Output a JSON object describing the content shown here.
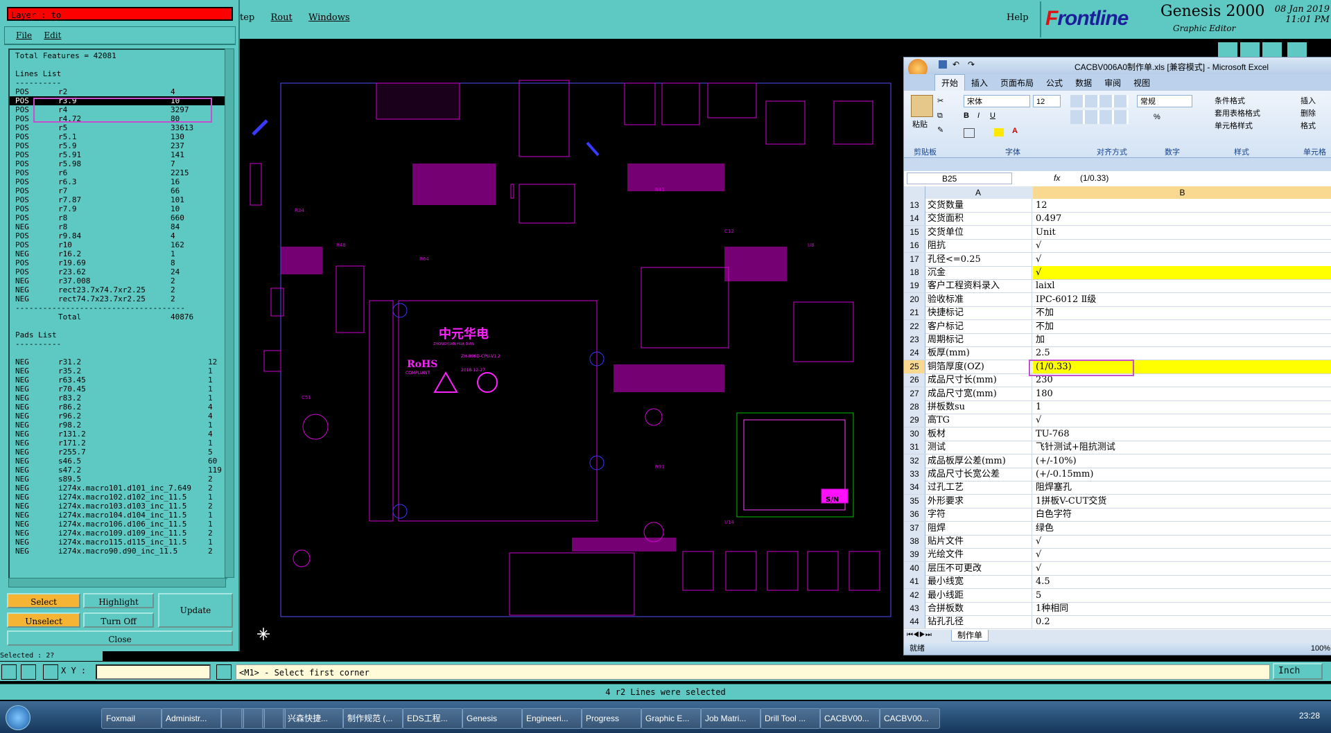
{
  "app": {
    "menu_partial": "tep",
    "menu_rout": "Rout",
    "menu_windows": "Windows",
    "menu_help": "Help",
    "brand_f": "F",
    "brand_rest": "rontline",
    "product": "Genesis 2000",
    "subtitle": "Graphic Editor",
    "date": "08 Jan 2019",
    "time": "11:01 PM"
  },
  "panel": {
    "layer_label": "Layer :  to",
    "menu_file": "File",
    "menu_edit": "Edit",
    "total_features": "Total Features = 42081",
    "lines_title": "Lines List",
    "dashes": "----------",
    "lines": [
      {
        "pol": "POS",
        "sym": "r2",
        "cnt": "4",
        "sel": false
      },
      {
        "pol": "POS",
        "sym": "r3.9",
        "cnt": "10",
        "sel": true
      },
      {
        "pol": "POS",
        "sym": "r4",
        "cnt": "3297",
        "sel": false
      },
      {
        "pol": "POS",
        "sym": "r4.72",
        "cnt": "80",
        "sel": false
      },
      {
        "pol": "POS",
        "sym": "r5",
        "cnt": "33613",
        "sel": false
      },
      {
        "pol": "POS",
        "sym": "r5.1",
        "cnt": "130",
        "sel": false
      },
      {
        "pol": "POS",
        "sym": "r5.9",
        "cnt": "237",
        "sel": false
      },
      {
        "pol": "POS",
        "sym": "r5.91",
        "cnt": "141",
        "sel": false
      },
      {
        "pol": "POS",
        "sym": "r5.98",
        "cnt": "7",
        "sel": false
      },
      {
        "pol": "POS",
        "sym": "r6",
        "cnt": "2215",
        "sel": false
      },
      {
        "pol": "POS",
        "sym": "r6.3",
        "cnt": "16",
        "sel": false
      },
      {
        "pol": "POS",
        "sym": "r7",
        "cnt": "66",
        "sel": false
      },
      {
        "pol": "POS",
        "sym": "r7.87",
        "cnt": "101",
        "sel": false
      },
      {
        "pol": "POS",
        "sym": "r7.9",
        "cnt": "10",
        "sel": false
      },
      {
        "pol": "POS",
        "sym": "r8",
        "cnt": "660",
        "sel": false
      },
      {
        "pol": "NEG",
        "sym": "r8",
        "cnt": "84",
        "sel": false
      },
      {
        "pol": "POS",
        "sym": "r9.84",
        "cnt": "4",
        "sel": false
      },
      {
        "pol": "POS",
        "sym": "r10",
        "cnt": "162",
        "sel": false
      },
      {
        "pol": "NEG",
        "sym": "r16.2",
        "cnt": "1",
        "sel": false
      },
      {
        "pol": "POS",
        "sym": "r19.69",
        "cnt": "8",
        "sel": false
      },
      {
        "pol": "POS",
        "sym": "r23.62",
        "cnt": "24",
        "sel": false
      },
      {
        "pol": "NEG",
        "sym": "r37.008",
        "cnt": "2",
        "sel": false
      },
      {
        "pol": "NEG",
        "sym": "rect23.7x74.7xr2.25",
        "cnt": "2",
        "sel": false
      },
      {
        "pol": "NEG",
        "sym": "rect74.7x23.7xr2.25",
        "cnt": "2",
        "sel": false
      }
    ],
    "long_dashes": "-------------------------------------",
    "total_label": "Total",
    "total_value": "40876",
    "pads_title": "Pads List",
    "pads": [
      {
        "pol": "NEG",
        "sym": "r31.2",
        "cnt": "12"
      },
      {
        "pol": "NEG",
        "sym": "r35.2",
        "cnt": "1"
      },
      {
        "pol": "NEG",
        "sym": "r63.45",
        "cnt": "1"
      },
      {
        "pol": "NEG",
        "sym": "r70.45",
        "cnt": "1"
      },
      {
        "pol": "NEG",
        "sym": "r83.2",
        "cnt": "1"
      },
      {
        "pol": "NEG",
        "sym": "r86.2",
        "cnt": "4"
      },
      {
        "pol": "NEG",
        "sym": "r96.2",
        "cnt": "4"
      },
      {
        "pol": "NEG",
        "sym": "r98.2",
        "cnt": "1"
      },
      {
        "pol": "NEG",
        "sym": "r131.2",
        "cnt": "4"
      },
      {
        "pol": "NEG",
        "sym": "r171.2",
        "cnt": "1"
      },
      {
        "pol": "NEG",
        "sym": "r255.7",
        "cnt": "5"
      },
      {
        "pol": "NEG",
        "sym": "s46.5",
        "cnt": "60"
      },
      {
        "pol": "NEG",
        "sym": "s47.2",
        "cnt": "119"
      },
      {
        "pol": "NEG",
        "sym": "s89.5",
        "cnt": "2"
      },
      {
        "pol": "NEG",
        "sym": "i274x.macro101.d101_inc_7.649",
        "cnt": "2"
      },
      {
        "pol": "NEG",
        "sym": "i274x.macro102.d102_inc_11.5",
        "cnt": "1"
      },
      {
        "pol": "NEG",
        "sym": "i274x.macro103.d103_inc_11.5",
        "cnt": "2"
      },
      {
        "pol": "NEG",
        "sym": "i274x.macro104.d104_inc_11.5",
        "cnt": "1"
      },
      {
        "pol": "NEG",
        "sym": "i274x.macro106.d106_inc_11.5",
        "cnt": "1"
      },
      {
        "pol": "NEG",
        "sym": "i274x.macro109.d109_inc_11.5",
        "cnt": "2"
      },
      {
        "pol": "NEG",
        "sym": "i274x.macro115.d115_inc_11.5",
        "cnt": "1"
      },
      {
        "pol": "NEG",
        "sym": "i274x.macro90.d90_inc_11.5",
        "cnt": "2"
      }
    ],
    "btn_select": "Select",
    "btn_highlight": "Highlight",
    "btn_update": "Update",
    "btn_unselect": "Unselect",
    "btn_turnoff": "Turn Off",
    "btn_close": "Close"
  },
  "pcb": {
    "brand_cn": "中元华电",
    "brand_en": "ZHONGYUAN HUA DIAN",
    "rohs": "RoHS",
    "compliant": "COMPLIANT",
    "board_id": "ZH-806D-CPU-V1.2",
    "date_code": "2018-12-27",
    "sn_label": "S/N"
  },
  "excel": {
    "title": "CACBV006A0制作单.xls  [兼容模式] - Microsoft Excel",
    "tabs": [
      "开始",
      "插入",
      "页面布局",
      "公式",
      "数据",
      "审阅",
      "视图"
    ],
    "font_name": "宋体",
    "font_size": "12",
    "number_format": "常规",
    "paste": "粘贴",
    "cond_format": "条件格式",
    "table_format": "套用表格格式",
    "cell_style": "单元格样式",
    "insert": "插入",
    "delete": "删除",
    "format": "格式",
    "groups": [
      "剪贴板",
      "字体",
      "对齐方式",
      "数字",
      "样式",
      "单元格"
    ],
    "name_box": "B25",
    "formula": "(1/0.33)",
    "col_a": "A",
    "col_b": "B",
    "rows": [
      {
        "n": "13",
        "a": "交货数量",
        "b": "12",
        "hl": false
      },
      {
        "n": "14",
        "a": "交货面积",
        "b": "0.497",
        "hl": false
      },
      {
        "n": "15",
        "a": "交货单位",
        "b": "Unit",
        "hl": false
      },
      {
        "n": "16",
        "a": "阻抗",
        "b": "√",
        "hl": false
      },
      {
        "n": "17",
        "a": "孔径<=0.25",
        "b": "√",
        "hl": false
      },
      {
        "n": "18",
        "a": "沉金",
        "b": "√",
        "hl": true
      },
      {
        "n": "19",
        "a": "客户工程资料录入",
        "b": "laixl",
        "hl": false
      },
      {
        "n": "20",
        "a": "验收标准",
        "b": "IPC-6012 Ⅱ级",
        "hl": false
      },
      {
        "n": "21",
        "a": "快捷标记",
        "b": "不加",
        "hl": false
      },
      {
        "n": "22",
        "a": "客户标记",
        "b": "不加",
        "hl": false
      },
      {
        "n": "23",
        "a": "周期标记",
        "b": "加",
        "hl": false
      },
      {
        "n": "24",
        "a": "板厚(mm)",
        "b": "2.5",
        "hl": false
      },
      {
        "n": "25",
        "a": "铜箔厚度(OZ)",
        "b": "(1/0.33)",
        "hl": true
      },
      {
        "n": "26",
        "a": "成品尺寸长(mm)",
        "b": "230",
        "hl": false
      },
      {
        "n": "27",
        "a": "成品尺寸宽(mm)",
        "b": "180",
        "hl": false
      },
      {
        "n": "28",
        "a": "拼板数su",
        "b": "1",
        "hl": false
      },
      {
        "n": "29",
        "a": "高TG",
        "b": "√",
        "hl": false
      },
      {
        "n": "30",
        "a": "板材",
        "b": "TU-768",
        "hl": false
      },
      {
        "n": "31",
        "a": "测试",
        "b": "飞针测试+阻抗测试",
        "hl": false
      },
      {
        "n": "32",
        "a": "成品板厚公差(mm)",
        "b": "(+/-10%)",
        "hl": false
      },
      {
        "n": "33",
        "a": "成品尺寸长宽公差",
        "b": "(+/-0.15mm)",
        "hl": false
      },
      {
        "n": "34",
        "a": "过孔工艺",
        "b": "阻焊塞孔",
        "hl": false
      },
      {
        "n": "35",
        "a": "外形要求",
        "b": "1拼板V-CUT交货",
        "hl": false
      },
      {
        "n": "36",
        "a": "字符",
        "b": "白色字符",
        "hl": false
      },
      {
        "n": "37",
        "a": "阻焊",
        "b": "绿色",
        "hl": false
      },
      {
        "n": "38",
        "a": "贴片文件",
        "b": "√",
        "hl": false
      },
      {
        "n": "39",
        "a": "光绘文件",
        "b": "√",
        "hl": false
      },
      {
        "n": "40",
        "a": "层压不可更改",
        "b": "√",
        "hl": false
      },
      {
        "n": "41",
        "a": "最小线宽",
        "b": "4.5",
        "hl": false
      },
      {
        "n": "42",
        "a": "最小线距",
        "b": "5",
        "hl": false
      },
      {
        "n": "43",
        "a": "合拼板数",
        "b": "1种相同",
        "hl": false
      },
      {
        "n": "44",
        "a": "钻孔孔径",
        "b": "0.2",
        "hl": false
      }
    ],
    "sheet": "制作单",
    "status": "就绪",
    "zoom": "100%"
  },
  "cmd": {
    "xy_label": "X Y :",
    "prompt": "<M1> - Select first corner",
    "units": "Inch",
    "message": "4 r2 Lines were selected",
    "left_status": "Selected : 2?"
  },
  "taskbar": {
    "items": [
      "Foxmail",
      "Administr...",
      "",
      "",
      "",
      "兴森快捷...",
      "制作规范 (...",
      "EDS工程...",
      "Genesis",
      "Engineeri...",
      "Progress",
      "Graphic E...",
      "Job Matri...",
      "Drill Tool ...",
      "CACBV00...",
      "CACBV00..."
    ],
    "time": "23:28"
  }
}
